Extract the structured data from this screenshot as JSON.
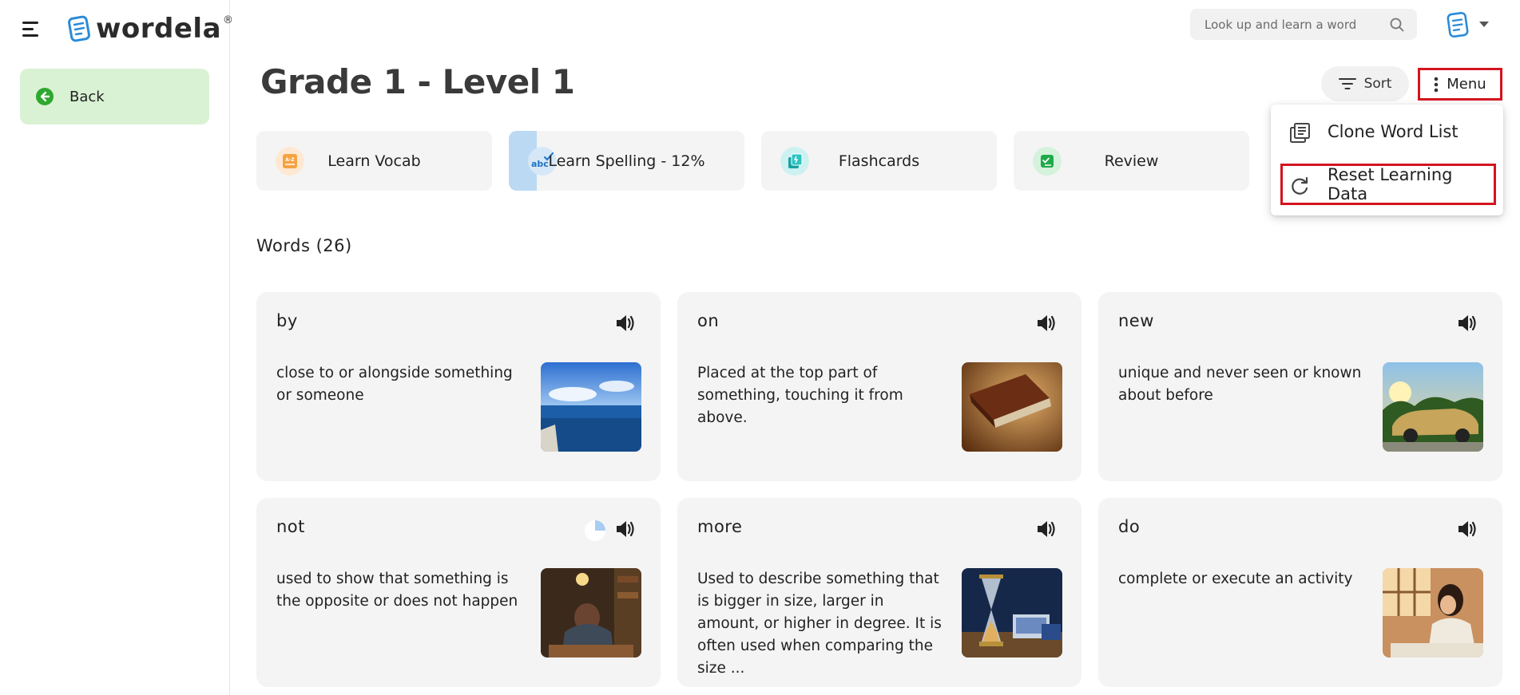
{
  "app": {
    "logo_text": "wordela",
    "logo_mark": "®"
  },
  "sidebar": {
    "back_label": "Back"
  },
  "search": {
    "placeholder": "Look up and learn a word"
  },
  "header": {
    "title": "Grade 1 - Level 1",
    "sort_label": "Sort",
    "menu_label": "Menu"
  },
  "activities": [
    {
      "label": "Learn Vocab",
      "icon": "az-book-icon"
    },
    {
      "label": "Learn Spelling - 12%",
      "icon": "abc-check-icon",
      "progress": 0.12
    },
    {
      "label": "Flashcards",
      "icon": "flashcards-icon"
    },
    {
      "label": "Review",
      "icon": "review-check-icon"
    }
  ],
  "words": {
    "title": "Words (26)",
    "items": [
      {
        "word": "by",
        "definition": "close to or alongside something or someone",
        "image": "ocean-shore"
      },
      {
        "word": "on",
        "definition": "Placed at the top part of something, touching it from above.",
        "image": "book-on-table"
      },
      {
        "word": "new",
        "definition": "unique and never seen or known about before",
        "image": "new-car"
      },
      {
        "word": "not",
        "definition": "used to show that something is the opposite or does not happen",
        "image": "student-frustrated",
        "progress": 0.25
      },
      {
        "word": "more",
        "definition": "Used to describe something that is bigger in size, larger in amount, or higher in degree. It is often used when comparing the size ...",
        "image": "hourglass-books"
      },
      {
        "word": "do",
        "definition": "complete or execute an activity",
        "image": "girl-studying"
      }
    ]
  },
  "menu_dropdown": {
    "items": [
      {
        "label": "Clone Word List",
        "icon": "library-icon"
      },
      {
        "label": "Reset Learning Data",
        "icon": "refresh-icon"
      }
    ]
  },
  "colors": {
    "back_bg": "#d9f2d4",
    "accent_green": "#2ea82e",
    "highlight_red": "#d4141e",
    "progress_blue": "#bcd9f4",
    "card_bg": "#f4f4f4"
  }
}
